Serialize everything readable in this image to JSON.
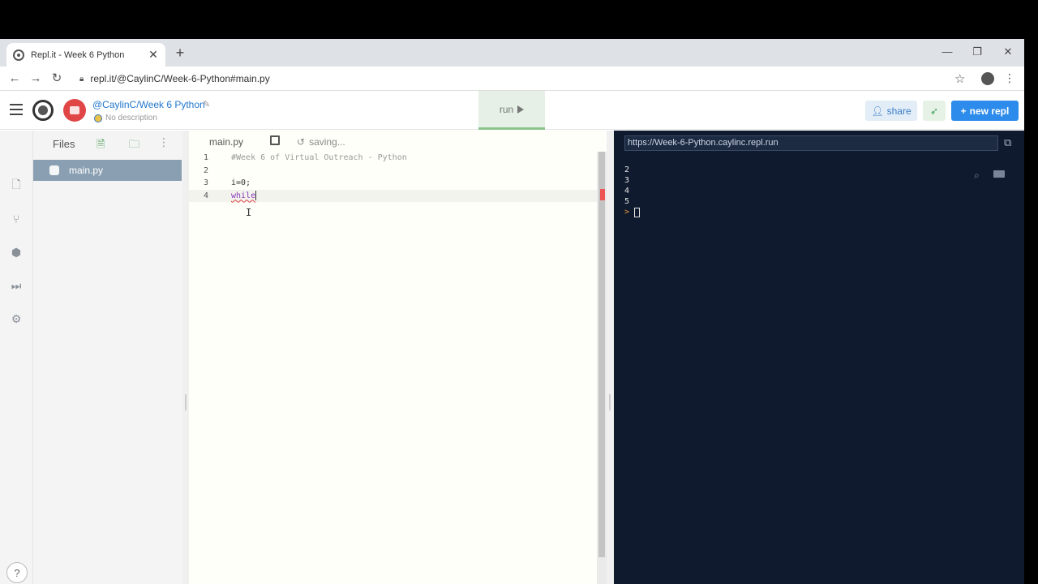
{
  "browser": {
    "tab_title": "Repl.it - Week 6 Python",
    "url": "repl.it/@CaylinC/Week-6-Python#main.py"
  },
  "header": {
    "owner": "@CaylinC",
    "separator": "/",
    "repl_name": "Week 6 Python",
    "description": "No description",
    "run_label": "run",
    "share_label": "share",
    "new_repl_label": "new repl"
  },
  "files": {
    "title": "Files",
    "items": [
      {
        "name": "main.py"
      }
    ]
  },
  "editor": {
    "tab_name": "main.py",
    "status": "saving...",
    "lines": [
      {
        "number": "1",
        "text": "#Week 6 of Virtual Outreach - Python"
      },
      {
        "number": "2",
        "text": ""
      },
      {
        "number": "3",
        "text": "i=0;"
      },
      {
        "number": "4",
        "text": "while"
      }
    ]
  },
  "console": {
    "url": "https://Week-6-Python.caylinc.repl.run",
    "output": [
      "2",
      "3",
      "4",
      "5"
    ],
    "prompt": ">"
  },
  "help_label": "?"
}
